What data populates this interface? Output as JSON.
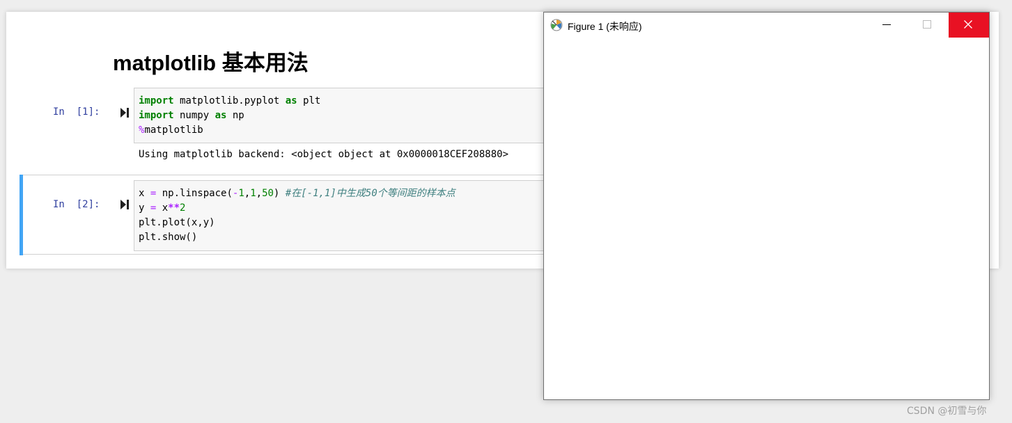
{
  "notebook": {
    "title": "matplotlib 基本用法",
    "cells": [
      {
        "prompt": "In  [1]:",
        "code": {
          "line1": {
            "kw1": "import",
            "rest": " matplotlib.pyplot ",
            "kw2": "as",
            "tail": " plt"
          },
          "line2": {
            "kw1": "import",
            "rest": " numpy ",
            "kw2": "as",
            "tail": " np"
          },
          "line3": {
            "magic": "%",
            "rest": "matplotlib"
          }
        },
        "output": "Using matplotlib backend: <object object at 0x0000018CEF208880>"
      },
      {
        "prompt": "In  [2]:",
        "code": {
          "line1": {
            "a": "x ",
            "eq": "=",
            "b": " np.linspace(",
            "neg": "-",
            "n1": "1",
            "c1": ",",
            "n2": "1",
            "c2": ",",
            "n3": "50",
            "close": ") ",
            "comment": "#在[-1,1]中生成50个等间距的样本点"
          },
          "line2": {
            "a": "y ",
            "eq": "=",
            "b": " x",
            "pow": "**",
            "n": "2"
          },
          "line3": "plt.plot(x,y)",
          "line4": "plt.show()"
        }
      }
    ]
  },
  "figure_window": {
    "title": "Figure 1 (未响应)",
    "icon": "matplotlib-app-icon",
    "buttons": [
      "minimize",
      "maximize",
      "close"
    ]
  },
  "watermark": "CSDN @初雪与你",
  "colors": {
    "selected_cell_bar": "#42a5f5",
    "prompt": "#303f9f",
    "keyword": "#008000",
    "operator": "#aa22ff",
    "comment": "#408080",
    "close_button": "#e81123"
  }
}
